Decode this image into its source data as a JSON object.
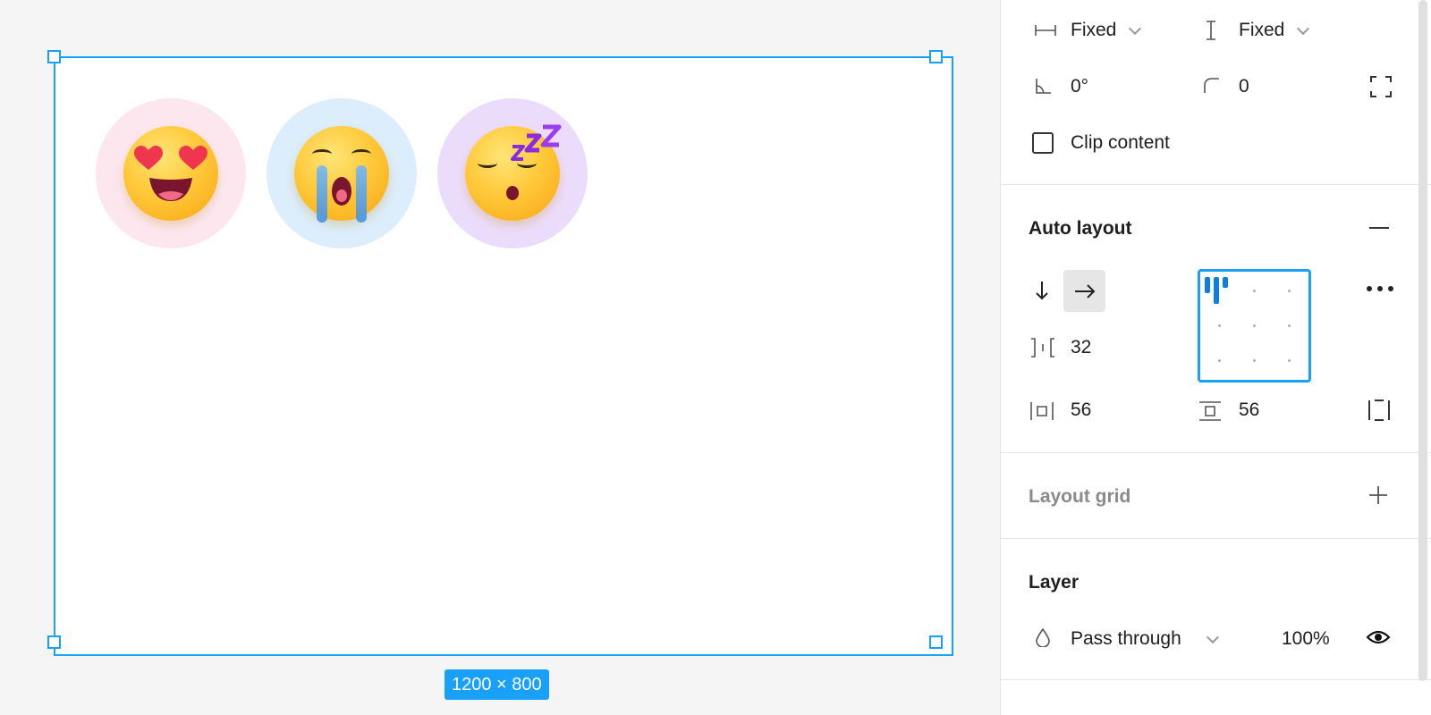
{
  "canvas": {
    "frame_size_label": "1200 × 800",
    "emojis": [
      {
        "name": "heart-eyes",
        "bg": "#fde7ef"
      },
      {
        "name": "crying",
        "bg": "#dcedfb"
      },
      {
        "name": "sleeping",
        "bg": "#ecdcfb"
      }
    ],
    "accent_color": "#18a0fb"
  },
  "panel": {
    "width_mode": "Fixed",
    "height_mode": "Fixed",
    "rotation": "0°",
    "corner_radius": "0",
    "clip_content_label": "Clip content",
    "clip_content_checked": false,
    "auto_layout": {
      "title": "Auto layout",
      "direction": "horizontal",
      "spacing": "32",
      "padding_horizontal": "56",
      "padding_vertical": "56",
      "alignment": "top-left"
    },
    "layout_grid": {
      "title": "Layout grid"
    },
    "layer": {
      "title": "Layer",
      "blend_mode": "Pass through",
      "opacity": "100%"
    }
  }
}
